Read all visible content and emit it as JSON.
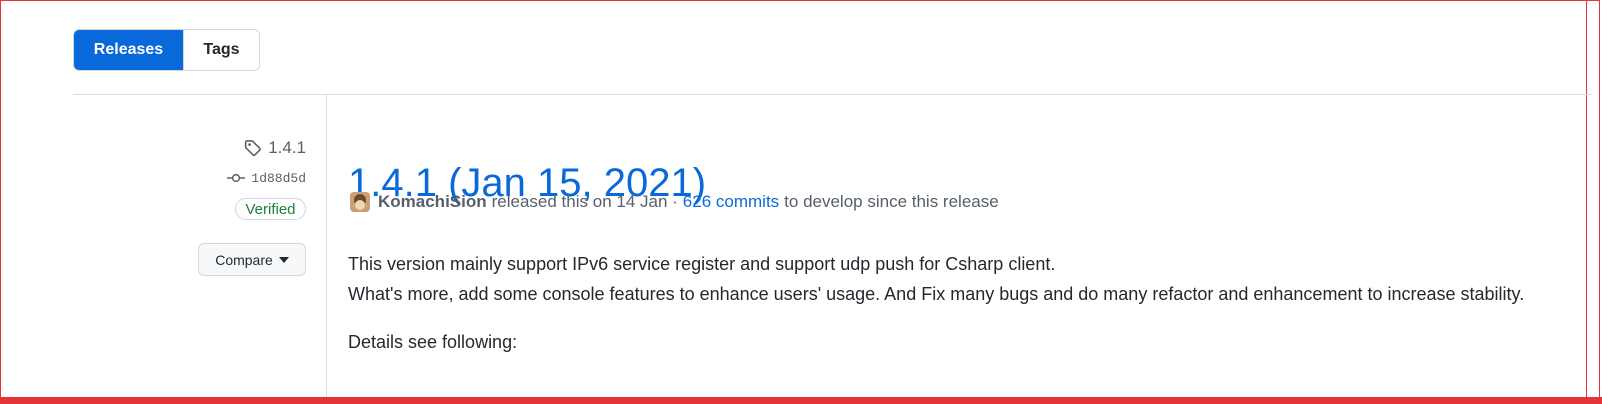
{
  "tabs": {
    "releases": "Releases",
    "tags": "Tags"
  },
  "release": {
    "tag": "1.4.1",
    "commit": "1d88d5d",
    "verified": "Verified",
    "compare": "Compare",
    "title": "1.4.1 (Jan 15, 2021)",
    "author": "KomachiSion",
    "released_text": "released this on 14 Jan ·",
    "commits_link": "626 commits",
    "since_text": "to develop since this release",
    "body": {
      "line1": "This version mainly support IPv6 service register and support udp push for Csharp client.",
      "line2": "What's more, add some console features to enhance users' usage. And Fix many bugs and do many refactor and enhancement to increase stability.",
      "line3": "Details see following:"
    }
  },
  "colors": {
    "accent": "#0969da",
    "verified": "#1a7f37",
    "frame": "#e4343a"
  },
  "icons": {
    "tag": "tag-icon",
    "commit": "git-commit-icon",
    "caret": "triangle-down-icon"
  }
}
